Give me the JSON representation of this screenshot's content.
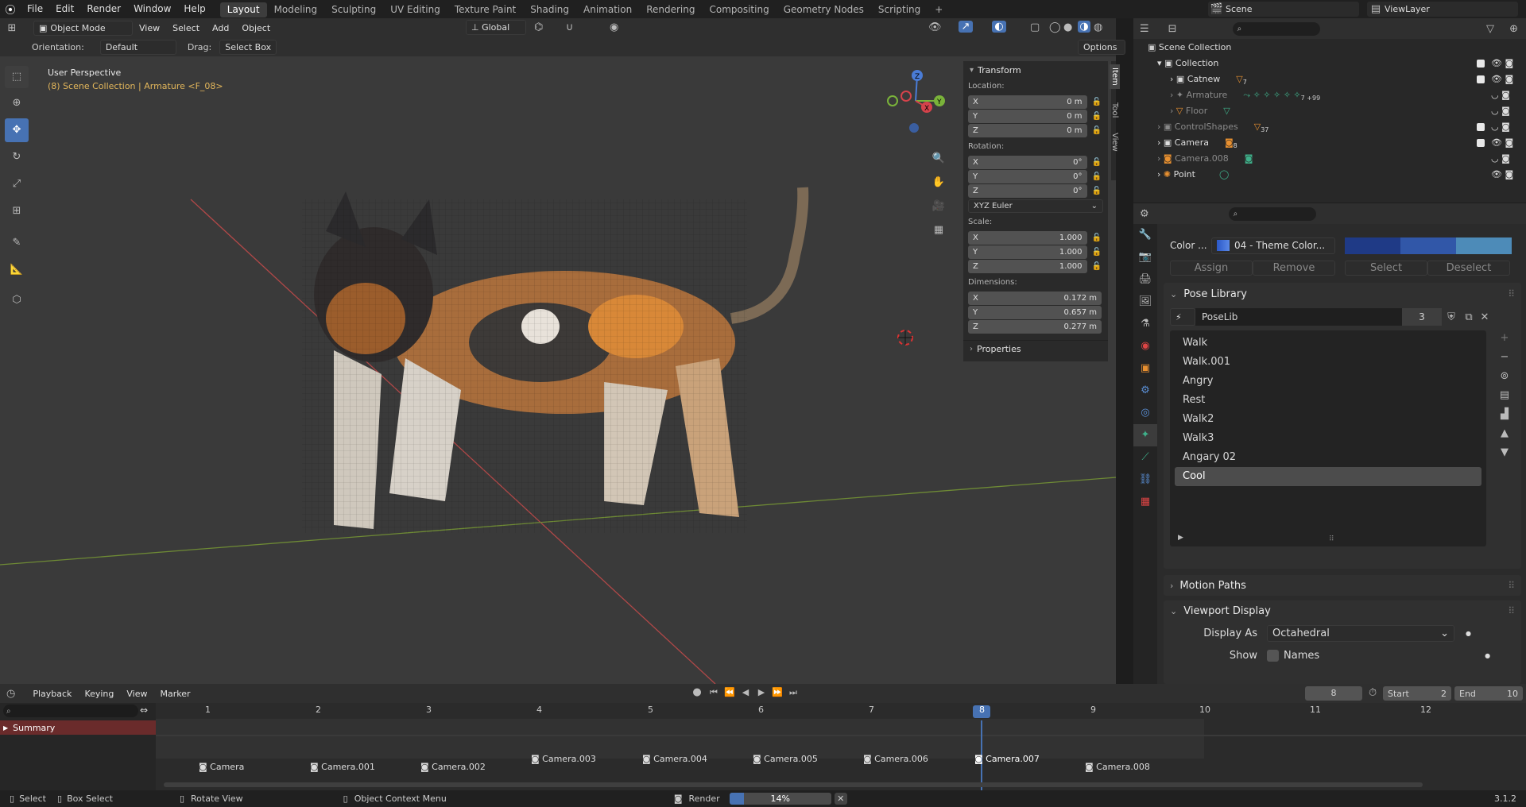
{
  "topbar": {
    "menus": [
      "File",
      "Edit",
      "Render",
      "Window",
      "Help"
    ],
    "workspaces": [
      "Layout",
      "Modeling",
      "Sculpting",
      "UV Editing",
      "Texture Paint",
      "Shading",
      "Animation",
      "Rendering",
      "Compositing",
      "Geometry Nodes",
      "Scripting"
    ],
    "active_workspace": "Layout",
    "add_tab": "+",
    "scene": "Scene",
    "view_layer": "ViewLayer"
  },
  "viewport": {
    "mode": "Object Mode",
    "menus": [
      "View",
      "Select",
      "Add",
      "Object"
    ],
    "transform_orientation": "Global",
    "orientation_label": "Orientation:",
    "orientation_value": "Default",
    "drag_label": "Drag:",
    "drag_value": "Select Box",
    "options": "Options",
    "view_name": "User Perspective",
    "context": "(8) Scene Collection | Armature <F_08>",
    "gizmo_axes": [
      "X",
      "Y",
      "Z"
    ]
  },
  "npanel": {
    "tabs": [
      "Item",
      "Tool",
      "View"
    ],
    "transform_title": "Transform",
    "location_label": "Location:",
    "location": [
      {
        "axis": "X",
        "value": "0 m"
      },
      {
        "axis": "Y",
        "value": "0 m"
      },
      {
        "axis": "Z",
        "value": "0 m"
      }
    ],
    "rotation_label": "Rotation:",
    "rotation": [
      {
        "axis": "X",
        "value": "0°"
      },
      {
        "axis": "Y",
        "value": "0°"
      },
      {
        "axis": "Z",
        "value": "0°"
      }
    ],
    "rotation_mode": "XYZ Euler",
    "scale_label": "Scale:",
    "scale": [
      {
        "axis": "X",
        "value": "1.000"
      },
      {
        "axis": "Y",
        "value": "1.000"
      },
      {
        "axis": "Z",
        "value": "1.000"
      }
    ],
    "dimensions_label": "Dimensions:",
    "dimensions": [
      {
        "axis": "X",
        "value": "0.172 m"
      },
      {
        "axis": "Y",
        "value": "0.657 m"
      },
      {
        "axis": "Z",
        "value": "0.277 m"
      }
    ],
    "properties_title": "Properties"
  },
  "outliner": {
    "root": "Scene Collection",
    "items": [
      {
        "name": "Collection",
        "badge": ""
      },
      {
        "name": "Catnew",
        "badge": "7"
      },
      {
        "name": "Armature",
        "badge": "7 +99"
      },
      {
        "name": "Floor",
        "badge": ""
      },
      {
        "name": "ControlShapes",
        "badge": "37"
      },
      {
        "name": "Camera",
        "badge": "8"
      },
      {
        "name": "Camera.008",
        "badge": ""
      },
      {
        "name": "Point",
        "badge": ""
      }
    ]
  },
  "properties": {
    "color_label": "Color ...",
    "color_set": "04 - Theme Color...",
    "assign": "Assign",
    "remove": "Remove",
    "select": "Select",
    "deselect": "Deselect",
    "pose_library_title": "Pose Library",
    "poselib_name": "PoseLib",
    "poselib_users": "3",
    "poses": [
      "Walk",
      "Walk.001",
      "Angry",
      "Rest",
      "Walk2",
      "Walk3",
      "Angary 02",
      "Cool"
    ],
    "selected_pose": "Cool",
    "motion_paths_title": "Motion Paths",
    "viewport_display_title": "Viewport Display",
    "display_as_label": "Display As",
    "display_as_value": "Octahedral",
    "show_label": "Show",
    "names_label": "Names"
  },
  "timeline": {
    "menus": [
      "Playback",
      "Keying",
      "View",
      "Marker"
    ],
    "current_frame": "8",
    "start_label": "Start",
    "start": "2",
    "end_label": "End",
    "end": "10",
    "frames": [
      "1",
      "2",
      "3",
      "4",
      "5",
      "6",
      "7",
      "8",
      "9",
      "10",
      "11",
      "12"
    ],
    "summary": "Summary",
    "markers": [
      "Camera",
      "Camera.001",
      "Camera.002",
      "Camera.003",
      "Camera.004",
      "Camera.005",
      "Camera.006",
      "Camera.007",
      "Camera.008"
    ]
  },
  "statusbar": {
    "select": "Select",
    "box_select": "Box Select",
    "rotate_view": "Rotate View",
    "context_menu": "Object Context Menu",
    "render_label": "Render",
    "render_progress": "14%",
    "render_fraction": 0.14,
    "version": "3.1.2"
  }
}
